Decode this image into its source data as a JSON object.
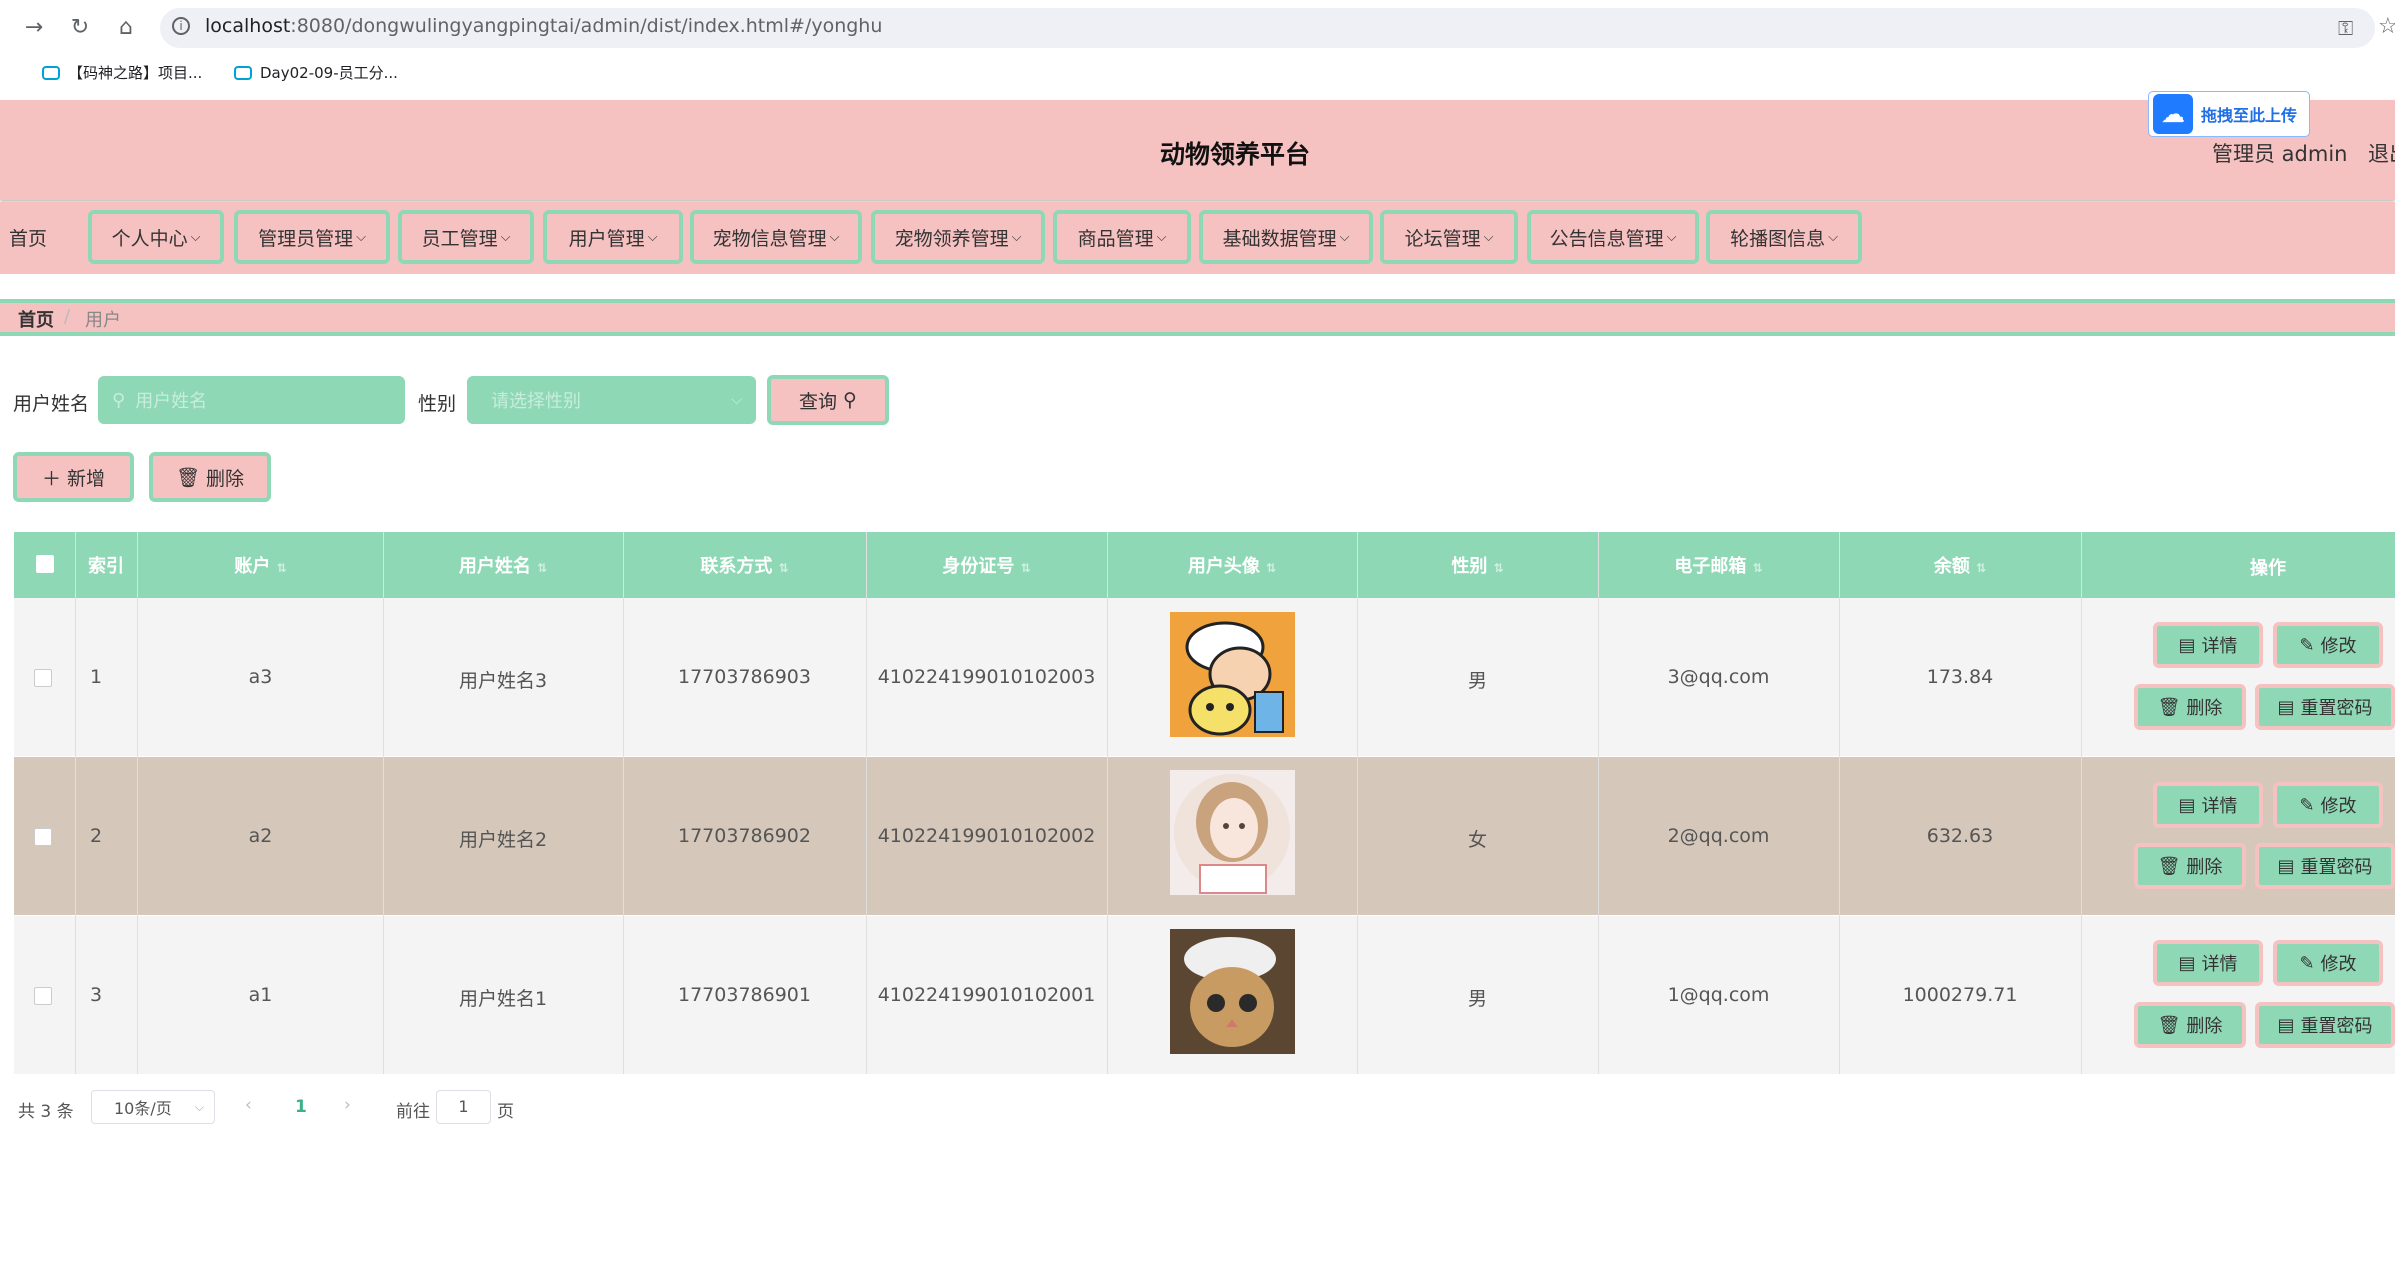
{
  "browser": {
    "url_host": "localhost",
    "url_rest": ":8080/dongwulingyangpingtai/admin/dist/index.html#/yonghu",
    "bookmarks": [
      "【码神之路】项目...",
      "Day02-09-员工分..."
    ]
  },
  "header": {
    "title": "动物领养平台",
    "admin": "管理员 admin",
    "logout": "退出",
    "upload_widget": "拖拽至此上传"
  },
  "menu": [
    {
      "label": "首页"
    },
    {
      "label": "个人中心"
    },
    {
      "label": "管理员管理"
    },
    {
      "label": "员工管理"
    },
    {
      "label": "用户管理"
    },
    {
      "label": "宠物信息管理"
    },
    {
      "label": "宠物领养管理"
    },
    {
      "label": "商品管理"
    },
    {
      "label": "基础数据管理"
    },
    {
      "label": "论坛管理"
    },
    {
      "label": "公告信息管理"
    },
    {
      "label": "轮播图信息"
    }
  ],
  "breadcrumb": {
    "home": "首页",
    "sep": "/",
    "current": "用户"
  },
  "search": {
    "name_label": "用户姓名",
    "name_placeholder": "用户姓名",
    "gender_label": "性别",
    "gender_placeholder": "请选择性别",
    "query_button": "查询"
  },
  "actions": {
    "add": "新增",
    "delete": "删除"
  },
  "table": {
    "columns": [
      "索引",
      "账户",
      "用户姓名",
      "联系方式",
      "身份证号",
      "用户头像",
      "性别",
      "电子邮箱",
      "余额",
      "操作"
    ],
    "rows": [
      {
        "index": "1",
        "account": "a3",
        "name": "用户姓名3",
        "phone": "17703786903",
        "idcard": "410224199010102003",
        "gender": "男",
        "email": "3@qq.com",
        "balance": "173.84"
      },
      {
        "index": "2",
        "account": "a2",
        "name": "用户姓名2",
        "phone": "17703786902",
        "idcard": "410224199010102002",
        "gender": "女",
        "email": "2@qq.com",
        "balance": "632.63"
      },
      {
        "index": "3",
        "account": "a1",
        "name": "用户姓名1",
        "phone": "17703786901",
        "idcard": "410224199010102001",
        "gender": "男",
        "email": "1@qq.com",
        "balance": "1000279.71"
      }
    ],
    "row_buttons": {
      "detail": "详情",
      "edit": "修改",
      "delete": "删除",
      "reset": "重置密码"
    }
  },
  "pagination": {
    "total": "共 3 条",
    "page_size": "10条/页",
    "current_page": "1",
    "goto_prefix": "前往",
    "goto_value": "1",
    "goto_suffix": "页"
  },
  "colors": {
    "pink": "#f6c1c1",
    "green": "#8fd8b6",
    "row_alt": "#d5c8bb",
    "row_bg": "#f4f4f4"
  }
}
